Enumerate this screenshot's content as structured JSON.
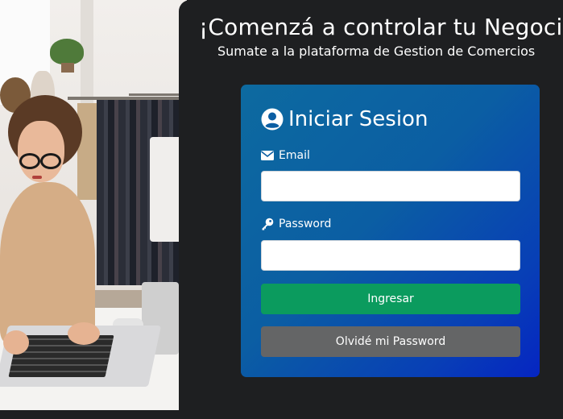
{
  "hero": {
    "headline": "¡Comenzá a controlar tu Negocio",
    "subheadline": "Sumate a la plataforma de Gestion de Comercios"
  },
  "login": {
    "title": "Iniciar Sesion",
    "title_icon": "user-circle-icon",
    "email_label": "Email",
    "email_icon": "envelope-icon",
    "email_value": "",
    "password_label": "Password",
    "password_icon": "key-icon",
    "password_value": "",
    "submit_label": "Ingresar",
    "forgot_label": "Olvidé mi Password"
  },
  "colors": {
    "panel_background": "#1e1f21",
    "card_gradient_start": "#0d6aa0",
    "card_gradient_end": "#0525c2",
    "submit_button": "#0b9b5e",
    "forgot_button": "#646566"
  }
}
